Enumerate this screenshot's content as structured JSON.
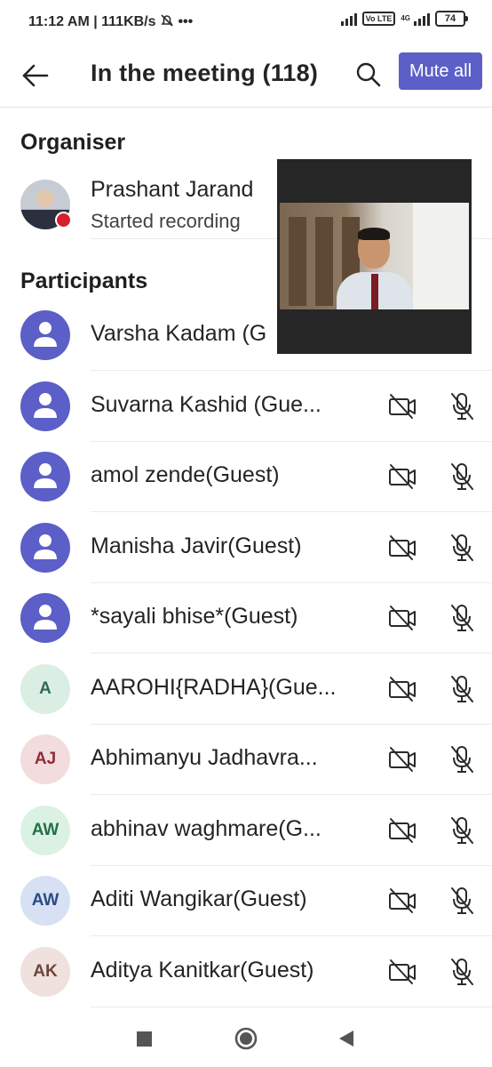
{
  "status_bar": {
    "time_and_speed": "11:12 AM | 111KB/s",
    "more": "•••",
    "volte": "Vo LTE",
    "network": "4G",
    "battery": "74"
  },
  "header": {
    "title": "In the meeting (118)",
    "mute_all_label": "Mute all"
  },
  "organiser_section": {
    "heading": "Organiser",
    "name": "Prashant Jarand",
    "status": "Started recording"
  },
  "participants_section": {
    "heading": "Participants",
    "items": [
      {
        "name": "Varsha Kadam (G",
        "avatar": "generic"
      },
      {
        "name": "Suvarna Kashid (Gue...",
        "avatar": "generic"
      },
      {
        "name": "amol zende(Guest)",
        "avatar": "generic"
      },
      {
        "name": "Manisha Javir(Guest)",
        "avatar": "generic"
      },
      {
        "name": "*sayali bhise*(Guest)",
        "avatar": "generic"
      },
      {
        "name": "AAROHI{RADHA}(Gue...",
        "avatar": "initials",
        "initials": "A",
        "bg": "#dbeee4",
        "fg": "#2f6a4e"
      },
      {
        "name": "Abhimanyu Jadhavra...",
        "avatar": "initials",
        "initials": "AJ",
        "bg": "#f2dcde",
        "fg": "#8d2d36"
      },
      {
        "name": "abhinav waghmare(G...",
        "avatar": "initials",
        "initials": "AW",
        "bg": "#dbf1e4",
        "fg": "#237048"
      },
      {
        "name": "Aditi Wangikar(Guest)",
        "avatar": "initials",
        "initials": "AW",
        "bg": "#d7e1f3",
        "fg": "#2a4c83"
      },
      {
        "name": "Aditya Kanitkar(Guest)",
        "avatar": "initials",
        "initials": "AK",
        "bg": "#eee1de",
        "fg": "#6e4639"
      }
    ]
  },
  "colors": {
    "accent": "#5b5fc7",
    "recording": "#d6202d"
  },
  "icons": {
    "back": "back-arrow-icon",
    "search": "search-icon",
    "camera_off": "camera-off-icon",
    "mic_off": "mic-off-icon",
    "person": "person-icon"
  }
}
